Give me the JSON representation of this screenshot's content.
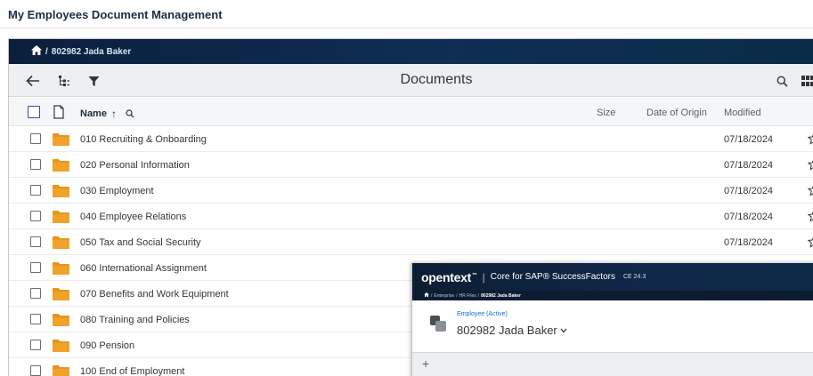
{
  "page": {
    "title": "My Employees Document Management"
  },
  "breadcrumb": {
    "separator": "/",
    "current": "802982 Jada Baker"
  },
  "toolbar": {
    "title": "Documents"
  },
  "table": {
    "columns": {
      "name": "Name",
      "size": "Size",
      "date_of_origin": "Date of Origin",
      "modified": "Modified"
    },
    "sort_arrow": "↑",
    "rows": [
      {
        "name": "010 Recruiting & Onboarding",
        "modified": "07/18/2024"
      },
      {
        "name": "020 Personal Information",
        "modified": "07/18/2024"
      },
      {
        "name": "030 Employment",
        "modified": "07/18/2024"
      },
      {
        "name": "040 Employee Relations",
        "modified": "07/18/2024"
      },
      {
        "name": "050 Tax and Social Security",
        "modified": "07/18/2024"
      },
      {
        "name": "060 International Assignment",
        "modified": ""
      },
      {
        "name": "070 Benefits and Work Equipment",
        "modified": ""
      },
      {
        "name": "080 Training and Policies",
        "modified": ""
      },
      {
        "name": "090 Pension",
        "modified": ""
      },
      {
        "name": "100 End of Employment",
        "modified": ""
      }
    ]
  },
  "overlay": {
    "brand": "opentext",
    "brand_tm": "™",
    "product": "Core for SAP® SuccessFactors",
    "version": "CE 24.3",
    "crumbs": [
      "/",
      "Enterprise",
      "/",
      "HR Files",
      "/",
      "802982 Jada Baker"
    ],
    "status": "Employee (Active)",
    "employee_name": "802982 Jada Baker",
    "add_symbol": "+"
  },
  "colors": {
    "folder": "#e8951c",
    "brand_bar": "#0f2d55",
    "link": "#0a6ed1"
  },
  "icons": [
    "home-icon",
    "back-arrow-icon",
    "tree-view-icon",
    "filter-icon",
    "search-icon",
    "grid-view-icon",
    "document-icon",
    "folder-icon",
    "star-outline-icon",
    "employee-icon",
    "chevron-down-icon",
    "add-icon"
  ]
}
